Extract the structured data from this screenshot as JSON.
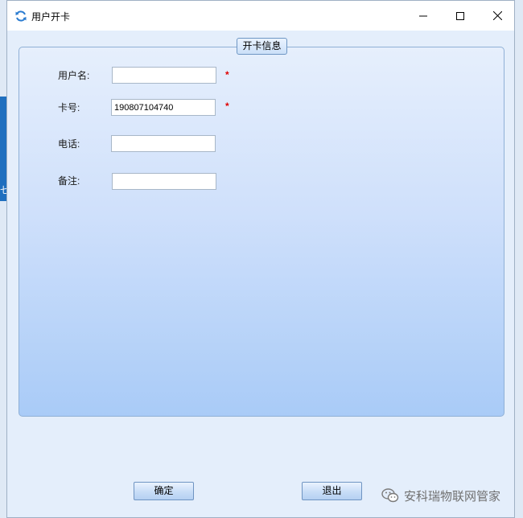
{
  "window": {
    "title": "用户开卡"
  },
  "background_app": {
    "glyph": "七"
  },
  "form": {
    "group_title": "开卡信息",
    "fields": [
      {
        "label": "用户名:",
        "value": "",
        "required": true
      },
      {
        "label": "卡号:",
        "value": "190807104740",
        "required": true
      },
      {
        "label": "电话:",
        "value": "",
        "required": false
      },
      {
        "label": "备注:",
        "value": "",
        "required": false
      }
    ],
    "required_mark": "*"
  },
  "buttons": {
    "confirm": "确定",
    "exit": "退出"
  },
  "watermark": {
    "text": "安科瑞物联网管家",
    "icon": "wechat-icon"
  },
  "colors": {
    "required": "#e00000",
    "accent": "#2a7bd0"
  }
}
